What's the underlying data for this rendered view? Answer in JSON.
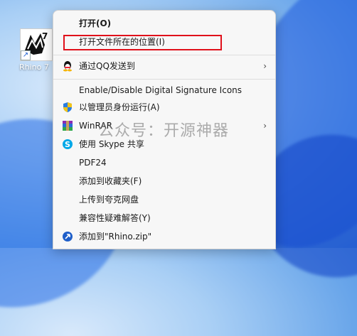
{
  "desktop": {
    "shortcut_label": "Rhino 7"
  },
  "context_menu": {
    "items": [
      {
        "label": "打开(O)",
        "icon": "none"
      },
      {
        "label": "打开文件所在的位置(I)",
        "icon": "none"
      },
      {
        "label": "通过QQ发送到",
        "icon": "qq-icon",
        "submenu": true
      },
      {
        "label": "Enable/Disable Digital Signature Icons",
        "icon": "none"
      },
      {
        "label": "以管理员身份运行(A)",
        "icon": "uac-shield-icon"
      },
      {
        "label": "WinRAR",
        "icon": "winrar-icon",
        "submenu": true
      },
      {
        "label": "使用 Skype 共享",
        "icon": "skype-icon"
      },
      {
        "label": "PDF24",
        "icon": "none"
      },
      {
        "label": "添加到收藏夹(F)",
        "icon": "none"
      },
      {
        "label": "上传到夸克网盘",
        "icon": "none"
      },
      {
        "label": "兼容性疑难解答(Y)",
        "icon": "none"
      },
      {
        "label": "添加到\"Rhino.zip\"",
        "icon": "compress-icon"
      }
    ]
  },
  "watermark": "公众号：开源神器",
  "colors": {
    "highlight_border": "#e0111b",
    "menu_background": "#f7f7f7"
  }
}
